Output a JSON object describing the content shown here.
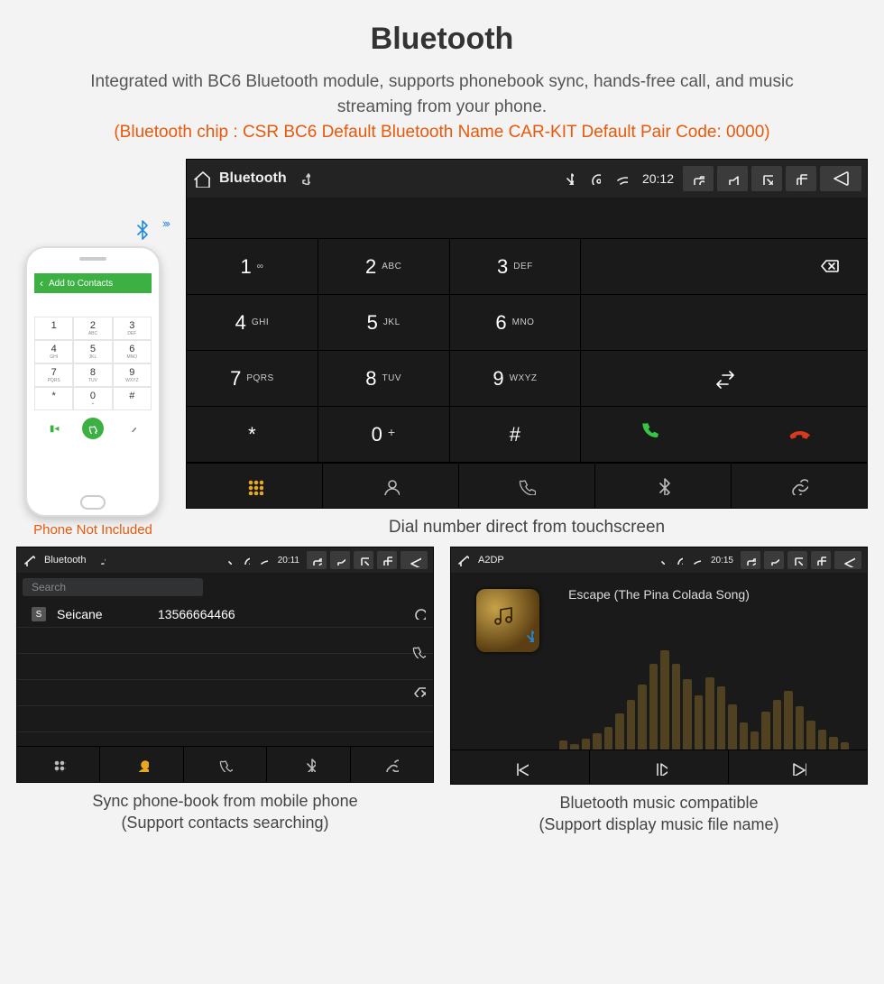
{
  "title": "Bluetooth",
  "description": "Integrated with BC6 Bluetooth module, supports phonebook sync, hands-free call, and music streaming from your phone.",
  "specs": "(Bluetooth chip : CSR BC6     Default Bluetooth Name CAR-KIT     Default Pair Code: 0000)",
  "phone_caption": "Phone Not Included",
  "captions": {
    "dial": "Dial number direct from touchscreen",
    "phonebook_l1": "Sync phone-book from mobile phone",
    "phonebook_l2": "(Support contacts searching)",
    "music_l1": "Bluetooth music compatible",
    "music_l2": "(Support display music file name)"
  },
  "status_large": {
    "title": "Bluetooth",
    "time": "20:12"
  },
  "status_pb": {
    "title": "Bluetooth",
    "time": "20:11"
  },
  "status_music": {
    "title": "A2DP",
    "time": "20:15"
  },
  "keypad": [
    {
      "n": "1",
      "s": "∞"
    },
    {
      "n": "2",
      "s": "ABC"
    },
    {
      "n": "3",
      "s": "DEF"
    },
    {
      "n": "4",
      "s": "GHI"
    },
    {
      "n": "5",
      "s": "JKL"
    },
    {
      "n": "6",
      "s": "MNO"
    },
    {
      "n": "7",
      "s": "PQRS"
    },
    {
      "n": "8",
      "s": "TUV"
    },
    {
      "n": "9",
      "s": "WXYZ"
    },
    {
      "n": "*",
      "s": ""
    },
    {
      "n": "0",
      "s": "+"
    },
    {
      "n": "#",
      "s": ""
    }
  ],
  "phonebook": {
    "search_placeholder": "Search",
    "contact_badge": "S",
    "contact_name": "Seicane",
    "contact_number": "13566664466"
  },
  "music": {
    "track": "Escape (The Pina Colada Song)",
    "eq_heights": [
      10,
      6,
      12,
      18,
      25,
      40,
      55,
      72,
      95,
      110,
      95,
      78,
      60,
      80,
      70,
      50,
      30,
      20,
      42,
      55,
      65,
      48,
      32,
      22,
      14,
      8
    ]
  },
  "mockphone": {
    "header": "Add to Contacts",
    "keys": [
      {
        "n": "1",
        "s": ""
      },
      {
        "n": "2",
        "s": "ABC"
      },
      {
        "n": "3",
        "s": "DEF"
      },
      {
        "n": "4",
        "s": "GHI"
      },
      {
        "n": "5",
        "s": "JKL"
      },
      {
        "n": "6",
        "s": "MNO"
      },
      {
        "n": "7",
        "s": "PQRS"
      },
      {
        "n": "8",
        "s": "TUV"
      },
      {
        "n": "9",
        "s": "WXYZ"
      },
      {
        "n": "*",
        "s": ""
      },
      {
        "n": "0",
        "s": "+"
      },
      {
        "n": "#",
        "s": ""
      }
    ]
  }
}
